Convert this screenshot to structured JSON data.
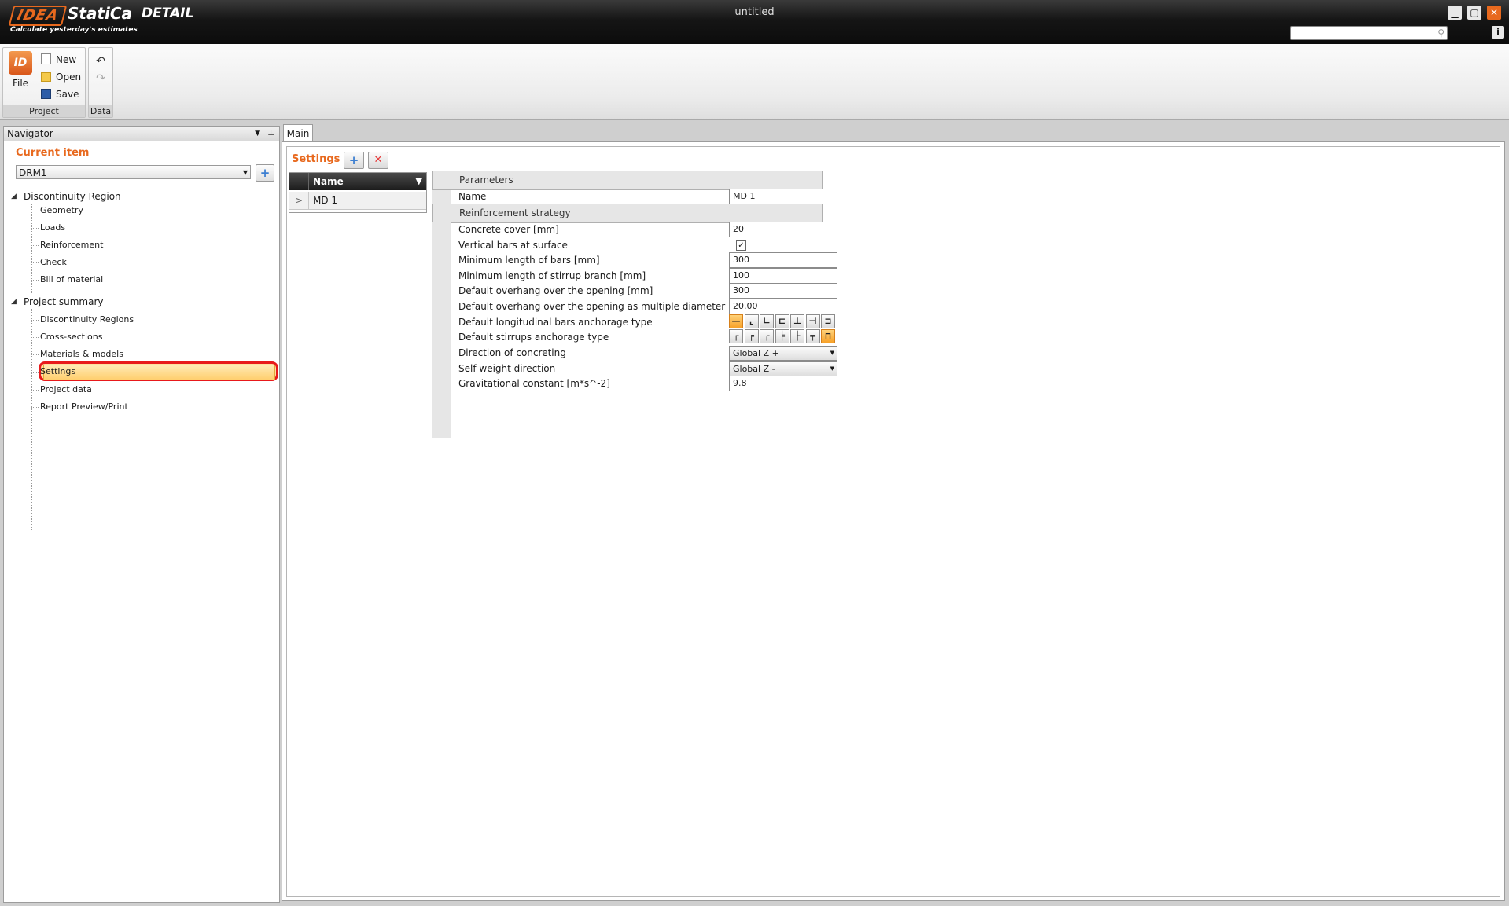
{
  "titlebar": {
    "logo_mark": "IDEA",
    "logo_name": "StatiCa",
    "product": "DETAIL",
    "tagline": "Calculate yesterday's estimates",
    "window_title": "untitled",
    "minimize": "▁",
    "maximize": "▢",
    "close": "✕",
    "search_placeholder": "",
    "info": "i"
  },
  "ribbon": {
    "file_label": "File",
    "file_icon_text": "ID",
    "new_label": "New",
    "open_label": "Open",
    "save_label": "Save",
    "project_group": "Project",
    "data_group": "Data",
    "undo": "↶",
    "redo": "↷"
  },
  "navigator": {
    "title": "Navigator",
    "current_item_label": "Current item",
    "current_item_value": "DRM1",
    "add_symbol": "+",
    "tree": {
      "group1": {
        "label": "Discontinuity Region",
        "items": [
          "Geometry",
          "Loads",
          "Reinforcement",
          "Check",
          "Bill of material"
        ]
      },
      "group2": {
        "label": "Project summary",
        "items": [
          "Discontinuity Regions",
          "Cross-sections",
          "Materials & models",
          "Settings",
          "Project data",
          "Report Preview/Print"
        ]
      }
    },
    "selected_item": "Settings"
  },
  "main": {
    "tab_label": "Main",
    "section_title": "Settings",
    "add_symbol": "+",
    "delete_symbol": "✕",
    "list": {
      "column_header": "Name",
      "rows": [
        {
          "indicator": ">",
          "name": "MD 1"
        }
      ]
    },
    "properties": {
      "parameters_category": "Parameters",
      "name_label": "Name",
      "name_value": "MD 1",
      "reinforcement_category": "Reinforcement strategy",
      "concrete_cover_label": "Concrete cover [mm]",
      "concrete_cover_value": "20",
      "vertical_bars_label": "Vertical bars at surface",
      "vertical_bars_checked": "✓",
      "min_length_bars_label": "Minimum length of bars [mm]",
      "min_length_bars_value": "300",
      "min_length_stirrup_label": "Minimum length of stirrup branch [mm]",
      "min_length_stirrup_value": "100",
      "default_overhang_label": "Default overhang over the opening [mm]",
      "default_overhang_value": "300",
      "overhang_multiple_label": "Default overhang over the opening as multiple diameter [-]",
      "overhang_multiple_value": "20.00",
      "long_anchorage_label": "Default longitudinal bars anchorage type",
      "long_anchorage_options": [
        "—",
        "⌞",
        "∟",
        "⊏",
        "⊥",
        "⊣",
        "⊐"
      ],
      "long_anchorage_selected": 0,
      "stirrup_anchorage_label": "Default stirrups anchorage type",
      "stirrup_anchorage_options": [
        "┌",
        "╒",
        "╭",
        "╞",
        "├",
        "╤",
        "⊓"
      ],
      "stirrup_anchorage_selected": 6,
      "direction_concreting_label": "Direction of concreting",
      "direction_concreting_value": "Global Z +",
      "self_weight_label": "Self weight direction",
      "self_weight_value": "Global Z -",
      "grav_constant_label": "Gravitational constant [m*s^-2]",
      "grav_constant_value": "9.8"
    }
  },
  "colors": {
    "accent": "#e8691e",
    "highlight_ring": "#e8191b",
    "selection_fill": "#ffd27a"
  }
}
